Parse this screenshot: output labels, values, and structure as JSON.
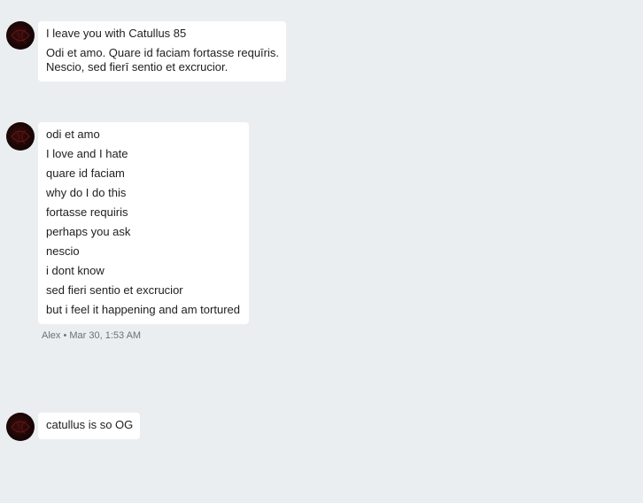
{
  "messages": [
    {
      "author_initial_icon": "avatar",
      "lines": [
        "I leave you with Catullus 85"
      ],
      "paragraph": [
        "Odi et amo. Quare id faciam fortasse requīris.",
        "Nescio, sed fierī sentio et excrucior."
      ]
    },
    {
      "lines": [
        "odi et amo",
        "I love and I hate",
        "quare id faciam",
        "why do I do this",
        "fortasse requiris",
        "perhaps you ask",
        "nescio",
        "i dont know",
        "sed fieri sentio et excrucior",
        "but i feel it happening and am tortured"
      ],
      "meta": "Alex • Mar 30, 1:53 AM"
    },
    {
      "lines": [
        "catullus is so OG"
      ]
    }
  ]
}
